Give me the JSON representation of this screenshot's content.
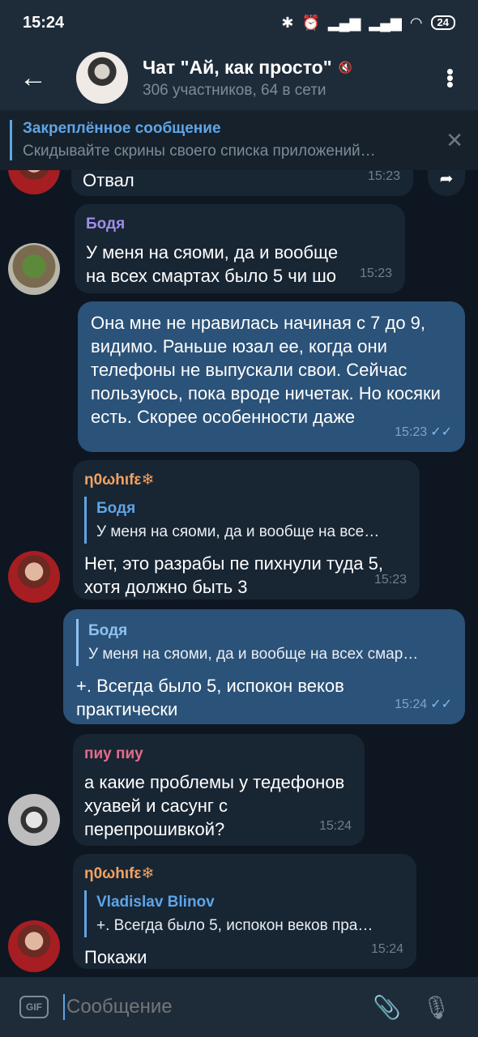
{
  "status": {
    "time": "15:24",
    "battery": "24",
    "icons": [
      "bluetooth-icon",
      "alarm-icon",
      "signal-icon",
      "signal-icon",
      "wifi-icon"
    ]
  },
  "header": {
    "title": "Чат \"Ай, как просто\"",
    "subtitle": "306 участников, 64 в сети"
  },
  "pinned": {
    "title": "Закреплённое сообщение",
    "text": "Скидывайте скрины своего списка приложений…"
  },
  "messages": [
    {
      "text": "Отвал",
      "time": "15:23"
    },
    {
      "sender": "Бодя",
      "sender_color": "#a08de8",
      "text": "У меня на сяоми, да и вообще на всех смартах было 5 чи шо",
      "time": "15:23"
    },
    {
      "text": "Она мне не нравилась начиная с 7 до 9, видимо. Раньше юзал ее, когда они телефоны не выпускали свои. Сейчас пользуюсь, пока вроде ничетак. Но косяки есть. Скорее особенности даже",
      "time": "15:23"
    },
    {
      "sender": "ƞ0ωhιfε❄",
      "sender_color": "#f4a261",
      "reply_name": "Бодя",
      "reply_text": "У меня на сяоми, да и вообще на все…",
      "text": "Нет, это разрабы пе пихнули туда 5, хотя должно быть 3",
      "time": "15:23"
    },
    {
      "reply_name": "Бодя",
      "reply_text": "У меня на сяоми, да и вообще на всех смар…",
      "text": "+. Всегда было 5, испокон веков практически",
      "time": "15:24"
    },
    {
      "sender": "пиу пиу",
      "sender_color": "#e46b8a",
      "text": "а какие проблемы у тедефонов хуавей и сасунг с перепрошивкой?",
      "time": "15:24"
    },
    {
      "sender": "ƞ0ωhιfε❄",
      "sender_color": "#f4a261",
      "reply_name": "Vladislav Blinov",
      "reply_text": "+. Всегда было 5, испокон веков пра…",
      "text": "Покажи",
      "time": "15:24"
    }
  ],
  "input": {
    "placeholder": "Сообщение",
    "gif_label": "GIF"
  }
}
